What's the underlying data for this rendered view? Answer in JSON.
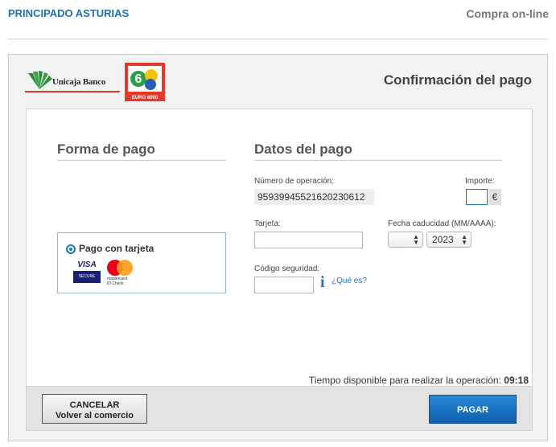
{
  "header": {
    "merchant_name": "PRINCIPADO ASTURIAS",
    "channel": "Compra on-line"
  },
  "logos": {
    "bank_name": "Unicaja Banco",
    "network_name": "EURO 6000"
  },
  "page": {
    "title": "Confirmación del pago"
  },
  "payment_method": {
    "title": "Forma de pago",
    "option_label": "Pago con tarjeta",
    "option_selected": true,
    "card_brands": [
      "VISA",
      "SECURE",
      "mastercard",
      "ID Check"
    ]
  },
  "payment_data": {
    "title": "Datos del pago",
    "operation_number_label": "Número de operación:",
    "operation_number": "95939945521620230612",
    "amount_label": "Importe:",
    "amount_value": "",
    "currency_symbol": "€",
    "card_label": "Tarjeta:",
    "card_value": "",
    "expiry_label": "Fecha caducidad (MM/AAAA):",
    "expiry_month": "",
    "expiry_year": "2023",
    "security_code_label": "Código seguridad:",
    "security_code_value": "",
    "what_is_link": "¿Qué es?"
  },
  "timer": {
    "label": "Tiempo disponible para realizar la operación:",
    "value": "09:18"
  },
  "actions": {
    "cancel_line1": "CANCELAR",
    "cancel_line2": "Volver al comercio",
    "pay_label": "PAGAR"
  },
  "colors": {
    "header_link": "#1f6fb2",
    "accent_blue": "#1f73c9",
    "pay_button": "#1a6fc0",
    "brand_red": "#d93a2b"
  }
}
